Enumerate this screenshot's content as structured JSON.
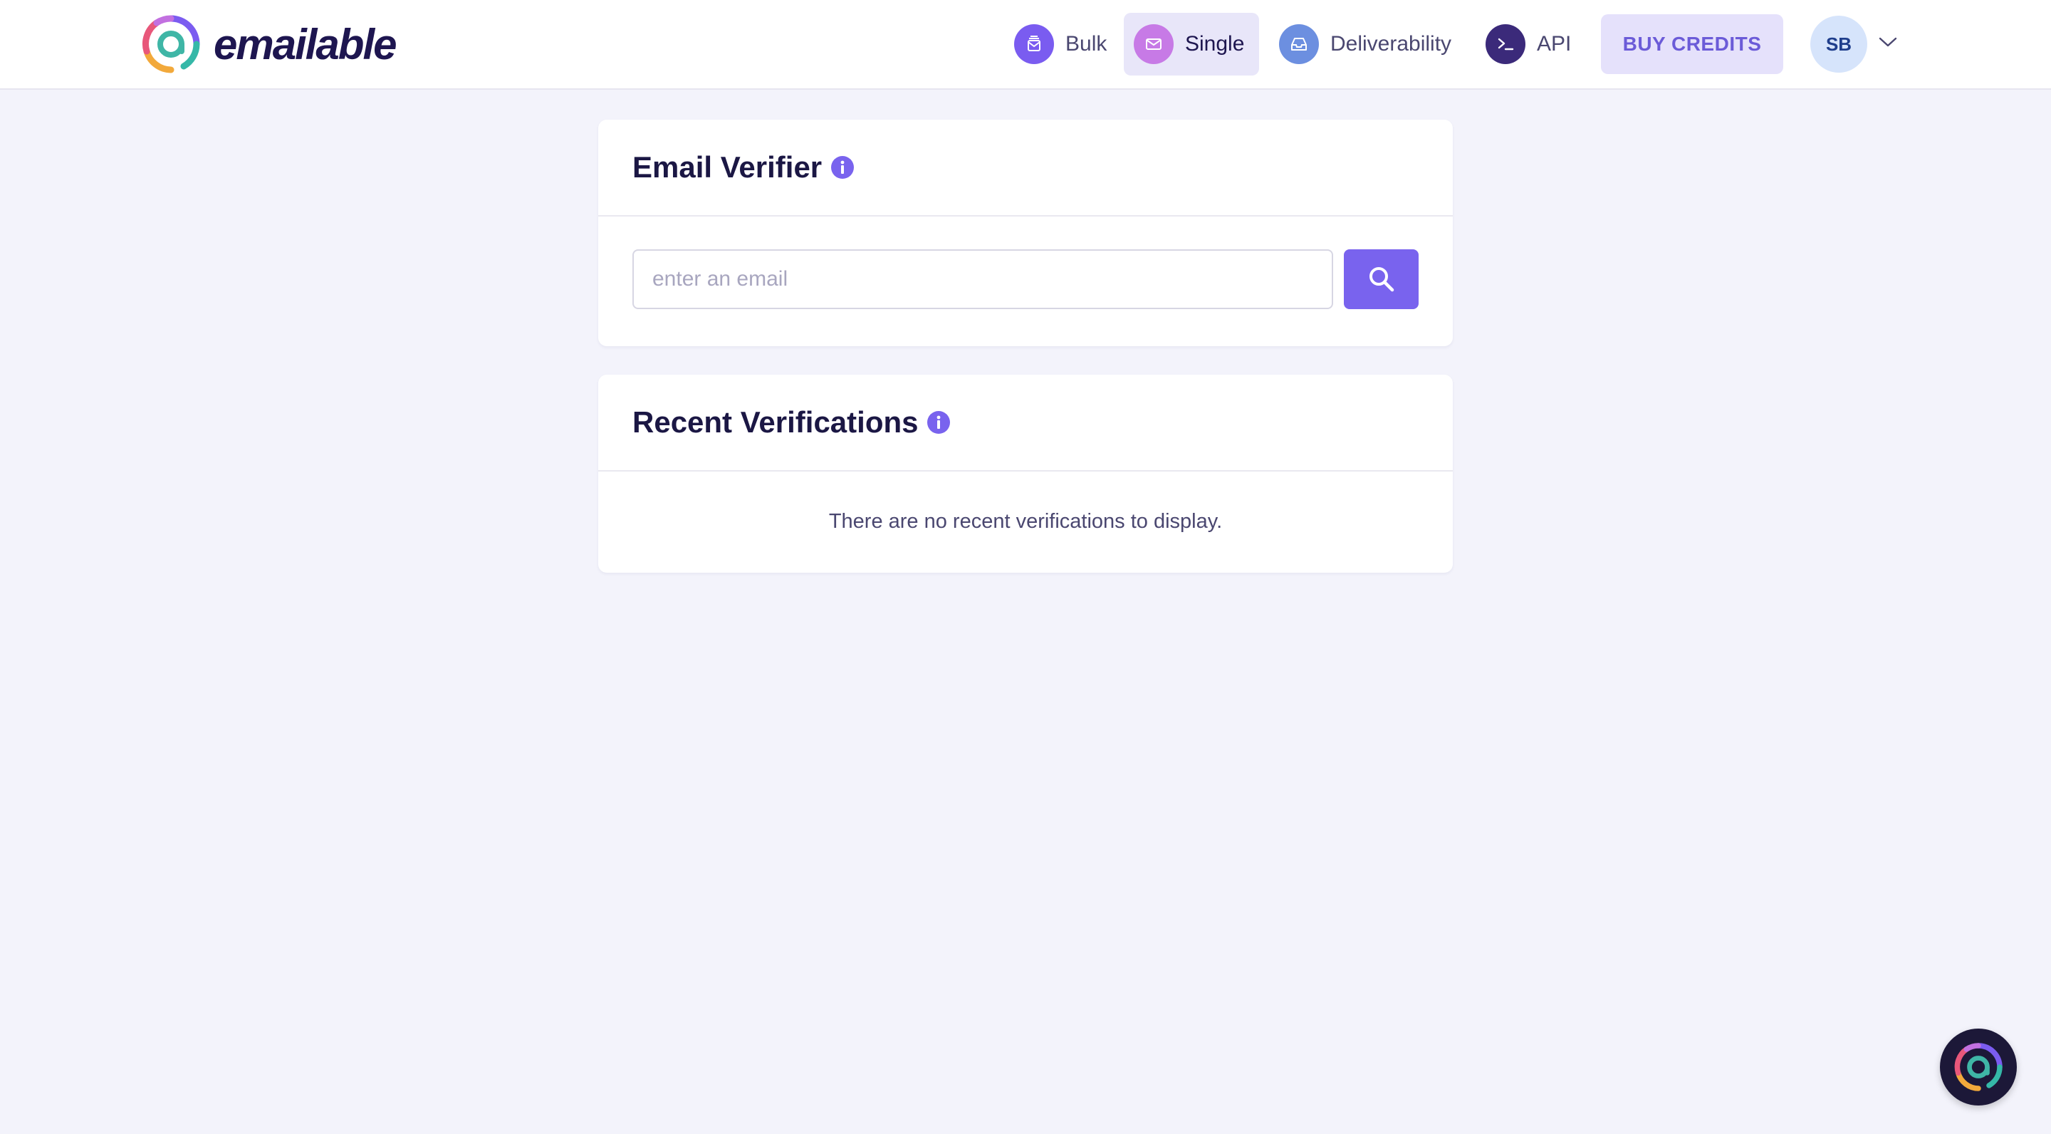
{
  "brand": {
    "name": "emailable"
  },
  "nav": {
    "items": [
      {
        "label": "Bulk",
        "icon": "bulk-icon",
        "active": false,
        "color": "#7a5cf0"
      },
      {
        "label": "Single",
        "icon": "envelope-icon",
        "active": true,
        "color": "#c77ae6"
      },
      {
        "label": "Deliverability",
        "icon": "inbox-icon",
        "active": false,
        "color": "#6c8fe0"
      },
      {
        "label": "API",
        "icon": "terminal-icon",
        "active": false,
        "color": "#3b2a7a"
      }
    ],
    "buy_credits": "BUY CREDITS",
    "avatar_initials": "SB"
  },
  "verifier": {
    "title": "Email Verifier",
    "input_placeholder": "enter an email",
    "input_value": ""
  },
  "recent": {
    "title": "Recent Verifications",
    "empty_message": "There are no recent verifications to display."
  },
  "colors": {
    "accent": "#7963ee",
    "background": "#f3f3fb",
    "active_nav_bg": "#e8e6f9"
  }
}
